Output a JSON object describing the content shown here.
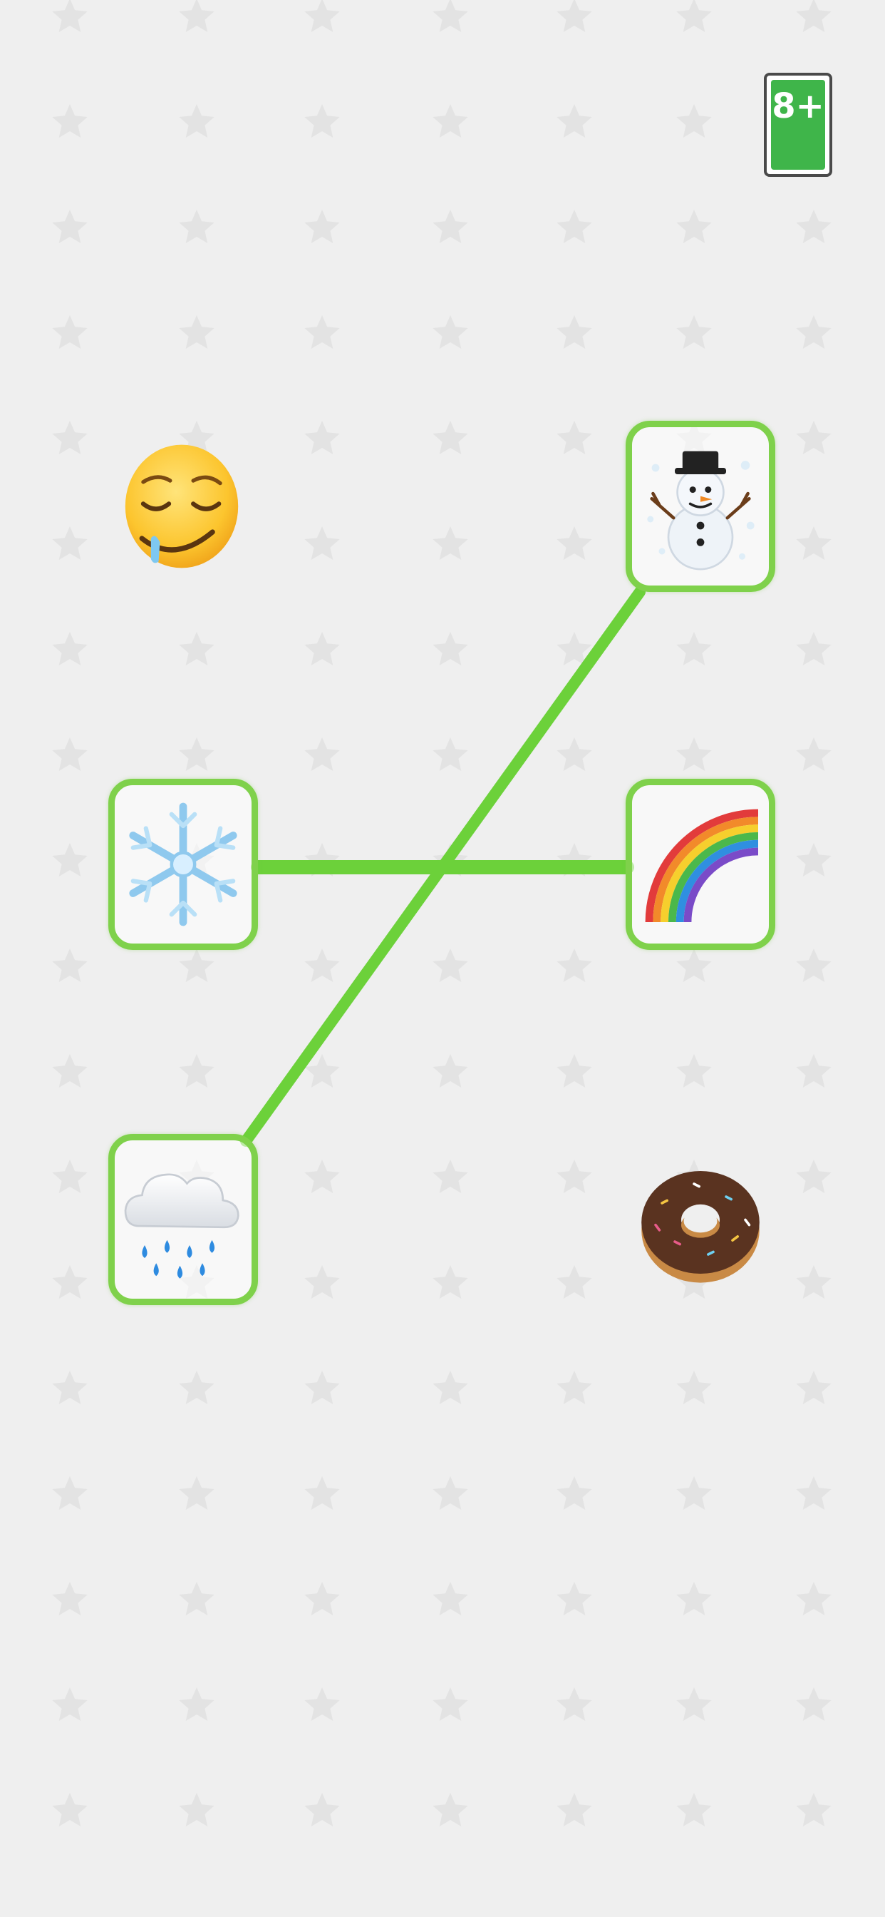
{
  "game": {
    "age_rating": {
      "label": "8+",
      "sub_label": "",
      "color": "#3fb54a"
    },
    "link_color": "#6cd13a",
    "background_color": "#efefef",
    "star_color": "#e3e3e3",
    "left_column": [
      {
        "icon": "drooling-face-icon",
        "selected": false
      },
      {
        "icon": "snowflake-icon",
        "selected": true
      },
      {
        "icon": "cloud-with-rain-icon",
        "selected": true
      }
    ],
    "right_column": [
      {
        "icon": "snowman-icon",
        "selected": true
      },
      {
        "icon": "rainbow-icon",
        "selected": true
      },
      {
        "icon": "doughnut-icon",
        "selected": false
      }
    ],
    "links": [
      {
        "from": "snowflake-icon",
        "to": "rainbow-icon"
      },
      {
        "from": "cloud-with-rain-icon",
        "to": "snowman-icon"
      }
    ]
  }
}
